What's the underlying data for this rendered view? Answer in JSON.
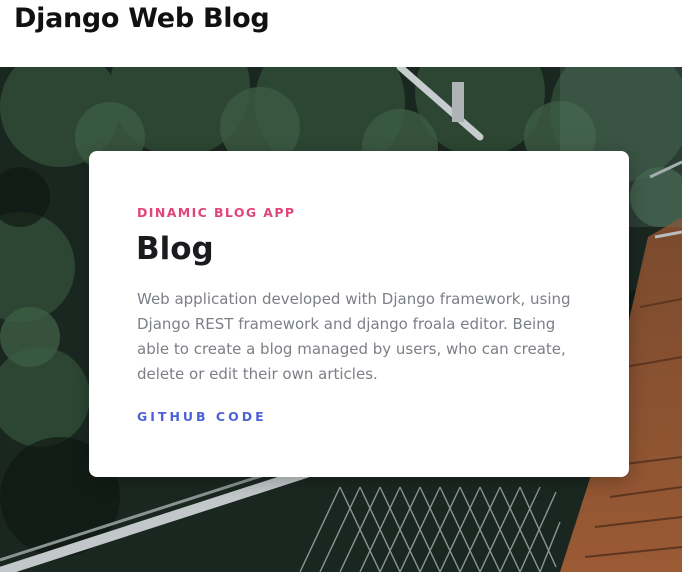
{
  "header": {
    "title": "Django Web Blog"
  },
  "card": {
    "eyebrow": "DINAMIC BLOG APP",
    "title": "Blog",
    "description": "Web application developed with Django framework, using Django REST framework and django froala editor. Being able to create a blog managed by users, who can create, delete or edit their own articles.",
    "link_label": "GITHUB CODE"
  },
  "colors": {
    "eyebrow": "#e0457b",
    "link": "#4d62d8",
    "title": "#1b1b1f",
    "description": "#7c7f86"
  }
}
